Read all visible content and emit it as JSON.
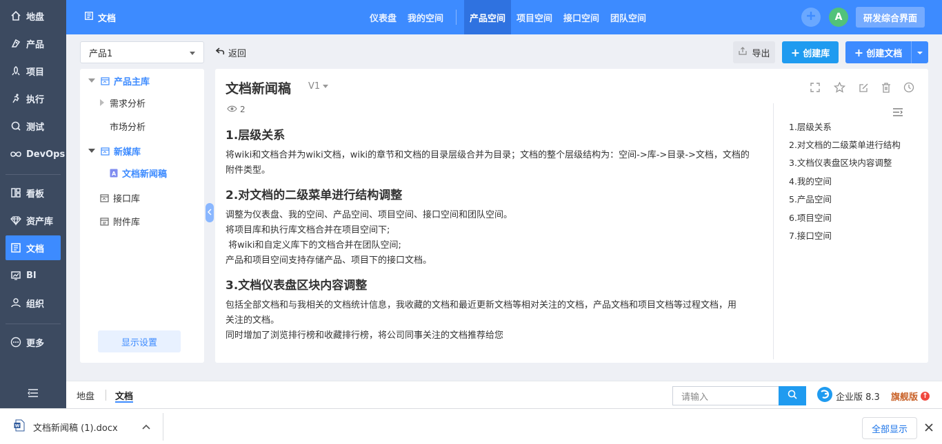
{
  "sidebar": {
    "items": [
      {
        "label": "地盘",
        "icon": "home-icon"
      },
      {
        "label": "产品",
        "icon": "product-icon"
      },
      {
        "label": "项目",
        "icon": "project-icon"
      },
      {
        "label": "执行",
        "icon": "execution-icon"
      },
      {
        "label": "测试",
        "icon": "test-icon"
      },
      {
        "label": "DevOps",
        "icon": "devops-icon"
      },
      {
        "label": "看板",
        "icon": "kanban-icon"
      },
      {
        "label": "资产库",
        "icon": "asset-icon"
      },
      {
        "label": "文档",
        "icon": "document-icon",
        "active": true
      },
      {
        "label": "BI",
        "icon": "bi-icon"
      },
      {
        "label": "组织",
        "icon": "organization-icon"
      },
      {
        "label": "更多",
        "icon": "more-icon"
      }
    ]
  },
  "topbar": {
    "title": "文档",
    "tabs": [
      "仪表盘",
      "我的空间",
      "产品空间",
      "项目空间",
      "接口空间",
      "团队空间"
    ],
    "active_tab": "产品空间",
    "avatar": "A",
    "rd_button": "研发综合界面"
  },
  "toolbar": {
    "product_select": "产品1",
    "back_label": "返回",
    "export_label": "导出",
    "create_lib_label": "创建库",
    "create_doc_label": "创建文档"
  },
  "tree": {
    "lib1": "产品主库",
    "lib1_child1": "需求分析",
    "lib1_child2": "市场分析",
    "lib2": "新媒库",
    "lib2_child1": "文档新闻稿",
    "lib3": "接口库",
    "lib4": "附件库",
    "display_settings": "显示设置"
  },
  "document": {
    "title": "文档新闻稿",
    "version": "V1",
    "views": "2",
    "sections": [
      {
        "heading": "1.层级关系",
        "lines": [
          "将wiki和文档合并为wiki文档，wiki的章节和文档的目录层级合并为目录；文档的整个层级结构为：空间->库->目录->文档，文档的",
          "附件类型。"
        ]
      },
      {
        "heading": "2.对文档的二级菜单进行结构调整",
        "lines": [
          "调整为仪表盘、我的空间、产品空间、项目空间、接口空间和团队空间。",
          "将项目库和执行库文档合并在项目空间下;",
          " 将wiki和自定义库下的文档合并在团队空间;",
          "产品和项目空间支持存储产品、项目下的接口文档。"
        ]
      },
      {
        "heading": "3.文档仪表盘区块内容调整",
        "lines": [
          "包括全部文档和与我相关的文档统计信息，我收藏的文档和最近更新文档等相对关注的文档，产品文档和项目文档等过程文档，用",
          "关注的文档。",
          "同时增加了浏览排行榜和收藏排行榜，将公司同事关注的文档推荐给您"
        ]
      }
    ],
    "outline": [
      "1.层级关系",
      "2.对文档的二级菜单进行结构",
      "3.文档仪表盘区块内容调整",
      "4.我的空间",
      "5.产品空间",
      "6.项目空间",
      "7.接口空间"
    ]
  },
  "bottom": {
    "tabs": [
      "地盘",
      "文档"
    ],
    "active_tab": "文档",
    "search_placeholder": "请输入",
    "edition": "企业版 8.3",
    "flagship": "旗舰版"
  },
  "download": {
    "filename": "文档新闻稿 (1).docx",
    "show_all": "全部显示"
  },
  "colors": {
    "primary": "#3d8bff",
    "nav_bg": "#3c4a60",
    "create_lib": "#1f9bf0"
  }
}
